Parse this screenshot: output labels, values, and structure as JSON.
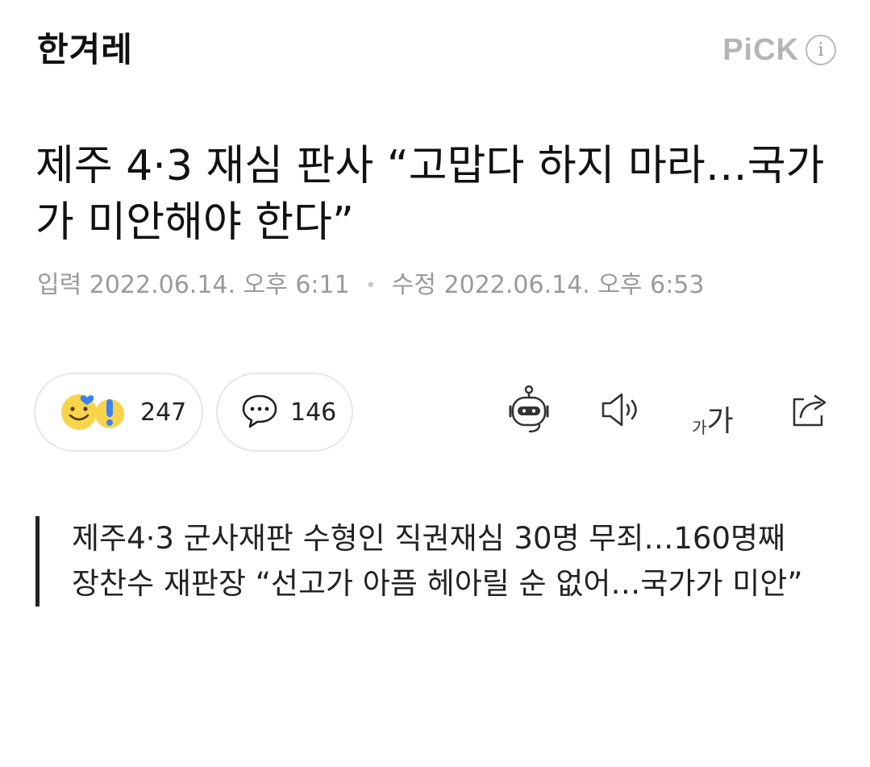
{
  "header": {
    "logo": "한겨레",
    "pick_label": "PiCK",
    "info_glyph": "i"
  },
  "article": {
    "title": "제주 4·3 재심 판사 “고맙다 하지 마라…국가가 미안해야 한다”",
    "published_label": "입력",
    "published": "2022.06.14. 오후 6:11",
    "modified_label": "수정",
    "modified": "2022.06.14. 오후 6:53",
    "subheads": [
      "제주4·3 군사재판 수형인 직권재심 30명 무죄…160명째",
      "장찬수 재판장 “선고가 아픔 헤아릴 순 없어…국가가 미안”"
    ]
  },
  "toolbar": {
    "reaction_count": "247",
    "comment_count": "146",
    "font_size_small": "가",
    "font_size_big": "가",
    "icons": [
      "reaction-emoji-icon",
      "comment-bubble-icon",
      "ai-robot-summary-icon",
      "speaker-tts-icon",
      "font-size-icon",
      "share-icon"
    ]
  },
  "colors": {
    "text": "#111111",
    "meta": "#9a9a9a",
    "pick": "#b5b5b5",
    "emoji_yellow": "#f7d44c",
    "emoji_blue": "#3b82f6"
  }
}
